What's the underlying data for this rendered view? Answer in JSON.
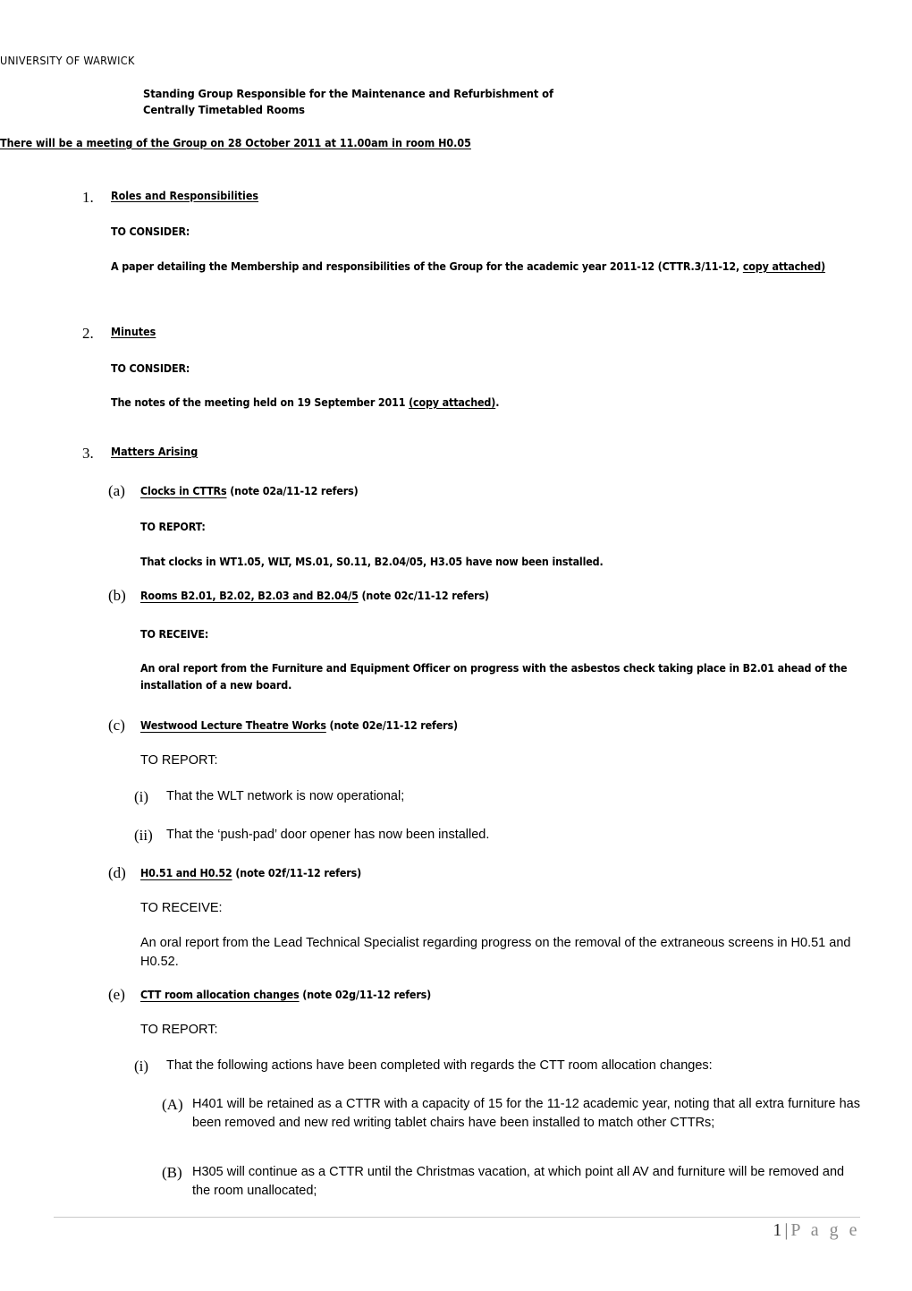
{
  "document": {
    "organisation": "UNIVERSITY OF WARWICK",
    "title_line1": "Standing Group Responsible for the Maintenance and Refurbishment of",
    "title_line2": "Centrally Timetabled Rooms",
    "meeting_notice": "There will be a meeting of the Group on 28 October 2011 at 11.00am in room H0.05",
    "footer": {
      "page_number": "1",
      "separator": "|",
      "page_word": "P a g e"
    }
  },
  "items": {
    "item1": {
      "number": "1.",
      "heading": "Roles and Responsibilities",
      "action": "TO CONSIDER:",
      "body_part1": "A paper detailing the Membership and responsibilities of the Group for the academic year 2011-12 (CTTR.3/11-12, ",
      "body_underlined": "copy attached)"
    },
    "item2": {
      "number": "2.",
      "heading": "Minutes",
      "action": "TO CONSIDER:",
      "body_part1": "The notes of the meeting held on 19 September 2011 ",
      "body_underlined": "(copy attached)",
      "body_part2": "."
    },
    "item3": {
      "number": "3.",
      "heading": "Matters Arising",
      "sub_a": {
        "mark": "(a)",
        "heading_underlined": "Clocks in CTTRs",
        "heading_note": " (note 02a/11-12 refers)",
        "action": "TO REPORT:",
        "body": "That clocks in WT1.05, WLT, MS.01, S0.11, B2.04/05, H3.05 have now been installed."
      },
      "sub_b": {
        "mark": "(b)",
        "heading_underlined": "Rooms B2.01, B2.02, B2.03 and B2.04/5",
        "heading_note": " (note 02c/11-12 refers)",
        "action": "TO RECEIVE:",
        "body": "An oral report from the Furniture and Equipment Officer on progress with the asbestos check taking place in B2.01 ahead of the installation of a new board."
      },
      "sub_c": {
        "mark": "(c)",
        "heading_underlined": "Westwood Lecture Theatre Works",
        "heading_note": " (note 02e/11-12 refers)",
        "action": "TO REPORT:",
        "points": [
          {
            "mark": "(i)",
            "text": "That the WLT network is now operational;"
          },
          {
            "mark": "(ii)",
            "text": "That the ‘push-pad’ door opener has now been installed."
          }
        ]
      },
      "sub_d": {
        "mark": "(d)",
        "heading_underlined": "H0.51 and H0.52",
        "heading_note": " (note 02f/11-12 refers)",
        "action": "TO RECEIVE:",
        "body": "An oral report from the Lead Technical Specialist regarding progress on the removal of the extraneous screens in H0.51 and H0.52."
      },
      "sub_e": {
        "mark": "(e)",
        "heading_underlined": "CTT room allocation changes",
        "heading_note": " (note 02g/11-12 refers)",
        "action": "TO REPORT:",
        "point_i": {
          "mark": "(i)",
          "text": "That the following actions have been completed with regards the CTT room allocation changes:"
        },
        "point_A": {
          "mark": "(A)",
          "text": "H401 will be retained as a CTTR with a capacity of 15 for the 11-12 academic year, noting that all extra furniture has been removed and new red writing tablet chairs have been installed to match other CTTRs;"
        },
        "point_B": {
          "mark": "(B)",
          "text": "H305 will continue as a CTTR until the Christmas vacation, at which point all AV and furniture will be removed and the room unallocated;"
        }
      }
    }
  }
}
